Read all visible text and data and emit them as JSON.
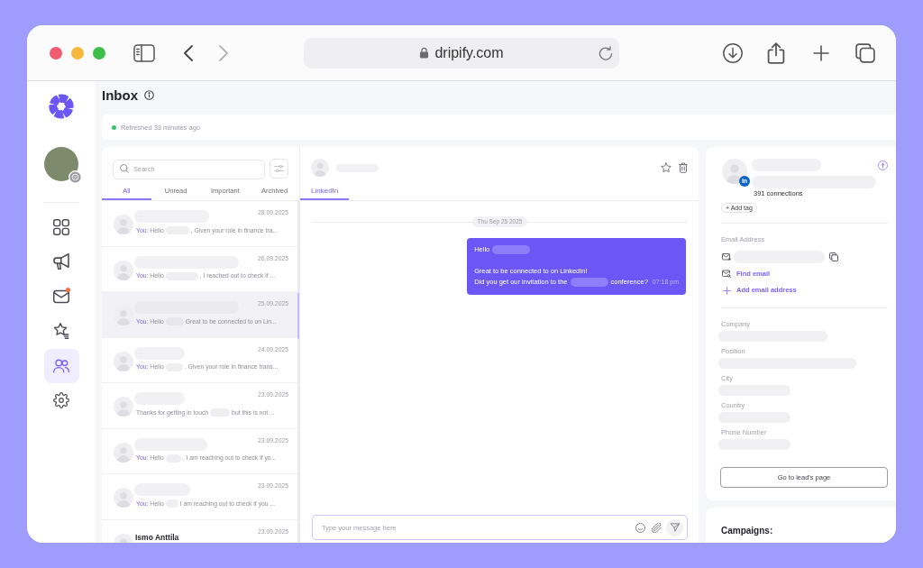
{
  "browser": {
    "url": "dripify.com"
  },
  "sidebar": {
    "items": [
      {
        "kind": "grid",
        "selected": false,
        "notification": false
      },
      {
        "kind": "megaphone",
        "selected": false,
        "notification": false
      },
      {
        "kind": "mail",
        "selected": false,
        "notification": true
      },
      {
        "kind": "star",
        "selected": false,
        "notification": false
      },
      {
        "kind": "people",
        "selected": true,
        "notification": false
      },
      {
        "kind": "gear",
        "selected": false,
        "notification": false
      }
    ]
  },
  "header": {
    "title": "Inbox",
    "refresh_status": "Refreshed 33 minutes ago"
  },
  "conversations": {
    "search": {
      "placeholder": "Search"
    },
    "tabs": [
      {
        "label": "All",
        "selected": true
      },
      {
        "label": "Unread",
        "selected": false
      },
      {
        "label": "Important",
        "selected": false
      },
      {
        "label": "Archived",
        "selected": false
      }
    ],
    "rows": [
      {
        "name": {
          "kind": "redacted"
        },
        "date": "28.09.2025",
        "selected": false,
        "preview": {
          "prefix": "You:",
          "segments": [
            {
              "kind": "text",
              "text": "Hello"
            },
            {
              "kind": "redacted"
            },
            {
              "kind": "text",
              "text": ", Given your role in finance tra..."
            }
          ]
        }
      },
      {
        "name": {
          "kind": "redacted"
        },
        "date": "26.09.2025",
        "selected": false,
        "preview": {
          "prefix": "You:",
          "segments": [
            {
              "kind": "text",
              "text": "Hello"
            },
            {
              "kind": "redacted"
            },
            {
              "kind": "text",
              "text": ", I reached out to check if ..."
            }
          ]
        }
      },
      {
        "name": {
          "kind": "redacted"
        },
        "date": "25.09.2025",
        "selected": true,
        "preview": {
          "prefix": "You:",
          "segments": [
            {
              "kind": "text",
              "text": "Hello"
            },
            {
              "kind": "redacted"
            },
            {
              "kind": "text",
              "text": "Great to be connected to on Lin..."
            }
          ]
        }
      },
      {
        "name": {
          "kind": "redacted"
        },
        "date": "24.09.2025",
        "selected": false,
        "preview": {
          "prefix": "You:",
          "segments": [
            {
              "kind": "text",
              "text": "Hello"
            },
            {
              "kind": "redacted"
            },
            {
              "kind": "text",
              "text": ". Given your role in finance trans..."
            }
          ]
        }
      },
      {
        "name": {
          "kind": "redacted"
        },
        "date": "23.09.2025",
        "selected": false,
        "preview": {
          "segments": [
            {
              "kind": "text",
              "text": "Thanks for getting in touch"
            },
            {
              "kind": "redacted"
            },
            {
              "kind": "text",
              "text": "but this is not ..."
            }
          ]
        }
      },
      {
        "name": {
          "kind": "redacted"
        },
        "date": "23.09.2025",
        "selected": false,
        "preview": {
          "prefix": "You:",
          "segments": [
            {
              "kind": "text",
              "text": "Hello"
            },
            {
              "kind": "redacted"
            },
            {
              "kind": "text",
              "text": ". I am reaching out to check if yo..."
            }
          ]
        }
      },
      {
        "name": {
          "kind": "redacted"
        },
        "date": "23.09.2025",
        "selected": false,
        "preview": {
          "prefix": "You:",
          "segments": [
            {
              "kind": "text",
              "text": "Hello"
            },
            {
              "kind": "redacted"
            },
            {
              "kind": "text",
              "text": "I am reaching out to check if you ..."
            }
          ]
        }
      },
      {
        "name": {
          "kind": "text",
          "text": "Ismo Anttila"
        },
        "date": "23.09.2025",
        "selected": false
      }
    ]
  },
  "chat": {
    "contact": {
      "kind": "redacted"
    },
    "tabs": [
      {
        "label": "LinkedIn",
        "selected": true
      }
    ],
    "date_divider": "Thu Sep 25 2025",
    "messages": [
      {
        "paragraphs": [
          {
            "lines": [
              [
                {
                  "kind": "text",
                  "text": "Hello"
                },
                {
                  "kind": "redacted"
                }
              ]
            ]
          },
          {
            "lines": [
              [
                {
                  "kind": "text",
                  "text": "Great to be connected to on LinkedIn!"
                }
              ],
              [
                {
                  "kind": "text",
                  "text": "Did you get our invitation to the"
                },
                {
                  "kind": "redacted"
                },
                {
                  "kind": "text",
                  "text": "conference?"
                }
              ]
            ]
          }
        ],
        "time": "07:18 pm"
      }
    ],
    "composer": {
      "placeholder": "Type your message here"
    }
  },
  "lead": {
    "name": {
      "kind": "redacted"
    },
    "headline": {
      "kind": "redacted"
    },
    "badge": "in",
    "connections": "391 connections",
    "add_tag": "+ Add tag",
    "email": {
      "label": "Email Address",
      "address": {
        "kind": "redacted"
      },
      "find": "Find email",
      "add": "Add email address"
    },
    "fields": [
      {
        "label": "Company",
        "value": {
          "kind": "redacted"
        }
      },
      {
        "label": "Position",
        "value": {
          "kind": "redacted"
        }
      },
      {
        "label": "City",
        "value": {
          "kind": "redacted"
        }
      },
      {
        "label": "Country",
        "value": {
          "kind": "redacted"
        }
      },
      {
        "label": "Phone Number",
        "value": {
          "kind": "redacted"
        }
      }
    ],
    "button": "Go to lead's page"
  },
  "campaigns": {
    "title": "Campaigns:"
  }
}
